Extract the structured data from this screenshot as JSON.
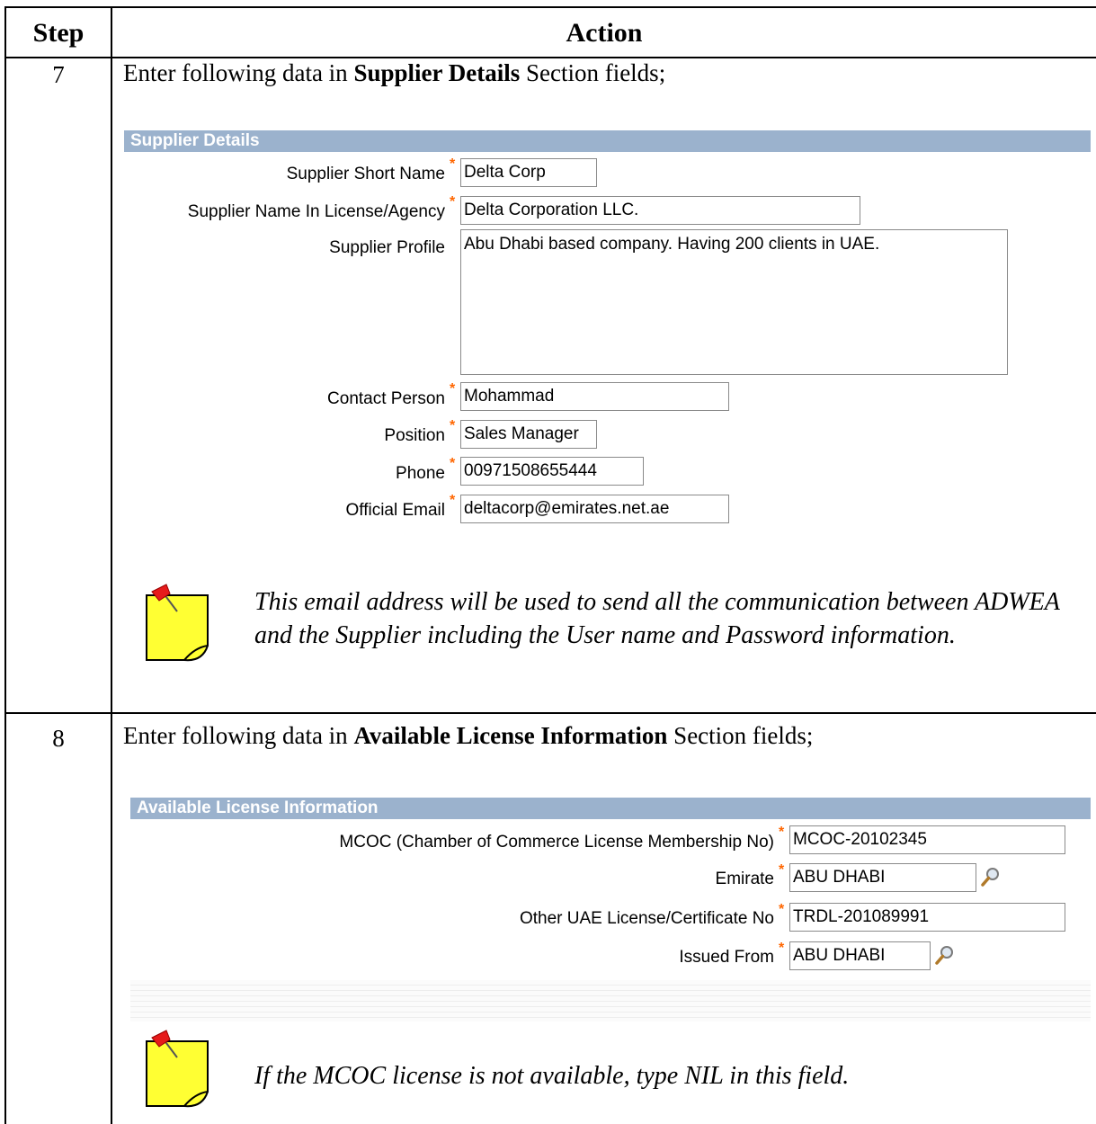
{
  "table": {
    "headers": {
      "step": "Step",
      "action": "Action"
    }
  },
  "step7": {
    "number": "7",
    "instruction_prefix": "Enter following data in ",
    "instruction_bold": "Supplier Details",
    "instruction_suffix": " Section fields;",
    "section_title": "Supplier Details",
    "fields": {
      "short_name": {
        "label": "Supplier Short Name",
        "value": "Delta Corp"
      },
      "license_name": {
        "label": "Supplier Name In License/Agency",
        "value": "Delta Corporation LLC."
      },
      "profile": {
        "label": "Supplier Profile",
        "value": "Abu Dhabi based company. Having 200 clients in UAE."
      },
      "contact": {
        "label": "Contact Person",
        "value": "Mohammad"
      },
      "position": {
        "label": "Position",
        "value": "Sales Manager"
      },
      "phone": {
        "label": "Phone",
        "value": "00971508655444"
      },
      "email": {
        "label": "Official Email",
        "value": "deltacorp@emirates.net.ae"
      }
    },
    "required_mark": "*",
    "note": "This email address will be used to send all the communication between ADWEA and the Supplier including the User name and Password information."
  },
  "step8": {
    "number": "8",
    "instruction_prefix": "Enter following data in ",
    "instruction_bold": "Available License Information",
    "instruction_suffix": " Section fields;",
    "section_title": "Available License Information",
    "fields": {
      "mcoc": {
        "label": "MCOC (Chamber of Commerce License Membership No)",
        "value": "MCOC-20102345"
      },
      "emirate": {
        "label": "Emirate",
        "value": "ABU DHABI"
      },
      "other": {
        "label": "Other UAE License/Certificate No",
        "value": "TRDL-201089991"
      },
      "issued_from": {
        "label": "Issued From",
        "value": "ABU DHABI"
      }
    },
    "note": "If the MCOC license is not available, type NIL in this field."
  },
  "colors": {
    "section_bar": "#9bb2cd",
    "required": "#ff6600",
    "note_icon": "#ffff33"
  },
  "icons": {
    "lookup": "magnifier-icon",
    "note": "sticky-note-pin-icon"
  }
}
